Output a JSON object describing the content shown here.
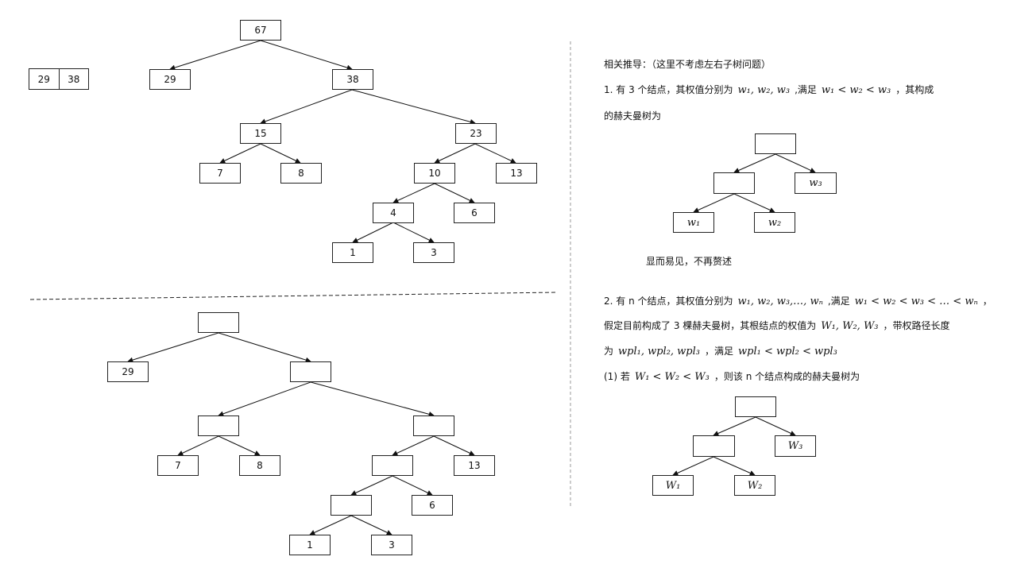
{
  "pair": [
    "29",
    "38"
  ],
  "tree_top": {
    "root": "67",
    "n29": "29",
    "n38": "38",
    "n15": "15",
    "n23": "23",
    "n7": "7",
    "n8": "8",
    "n10": "10",
    "n13": "13",
    "n4": "4",
    "n6": "6",
    "n1": "1",
    "n3": "3"
  },
  "tree_bottom": {
    "root": "",
    "n29": "29",
    "n38": "",
    "n15": "",
    "n23": "",
    "n7": "7",
    "n8": "8",
    "n10": "",
    "n13": "13",
    "n4": "",
    "n6": "6",
    "n1": "1",
    "n3": "3"
  },
  "derivation": {
    "heading": "相关推导：（这里不考虑左右子树问题）",
    "item1_a": "1. 有 3 个结点，其权值分别为",
    "item1_m1": "w₁, w₂, w₃",
    "item1_b": ",满足",
    "item1_m2": "w₁ < w₂ < w₃",
    "item1_c": "，其构成",
    "item1_line2": "的赫夫曼树为",
    "tree1": {
      "w1": "w₁",
      "w2": "w₂",
      "w3": "w₃"
    },
    "obvious": "显而易见，不再赘述",
    "item2_a": "2. 有 n 个结点，其权值分别为",
    "item2_m1": "w₁, w₂, w₃,…, wₙ",
    "item2_b": ",满足",
    "item2_m2": "w₁ < w₂ < w₃ < … < wₙ",
    "item2_c": "，",
    "item2_l2a": "假定目前构成了 3 棵赫夫曼树，其根结点的权值为",
    "item2_l2m": "W₁, W₂, W₃",
    "item2_l2b": "，带权路径长度",
    "item2_l3a": "为",
    "item2_l3m1": "wpl₁, wpl₂, wpl₃",
    "item2_l3b": "，满足",
    "item2_l3m2": "wpl₁ < wpl₂ < wpl₃",
    "item2_l4a": "(1) 若",
    "item2_l4m": "W₁ < W₂ < W₃",
    "item2_l4b": "，则该 n 个结点构成的赫夫曼树为",
    "tree2": {
      "W1": "W₁",
      "W2": "W₂",
      "W3": "W₃"
    }
  }
}
